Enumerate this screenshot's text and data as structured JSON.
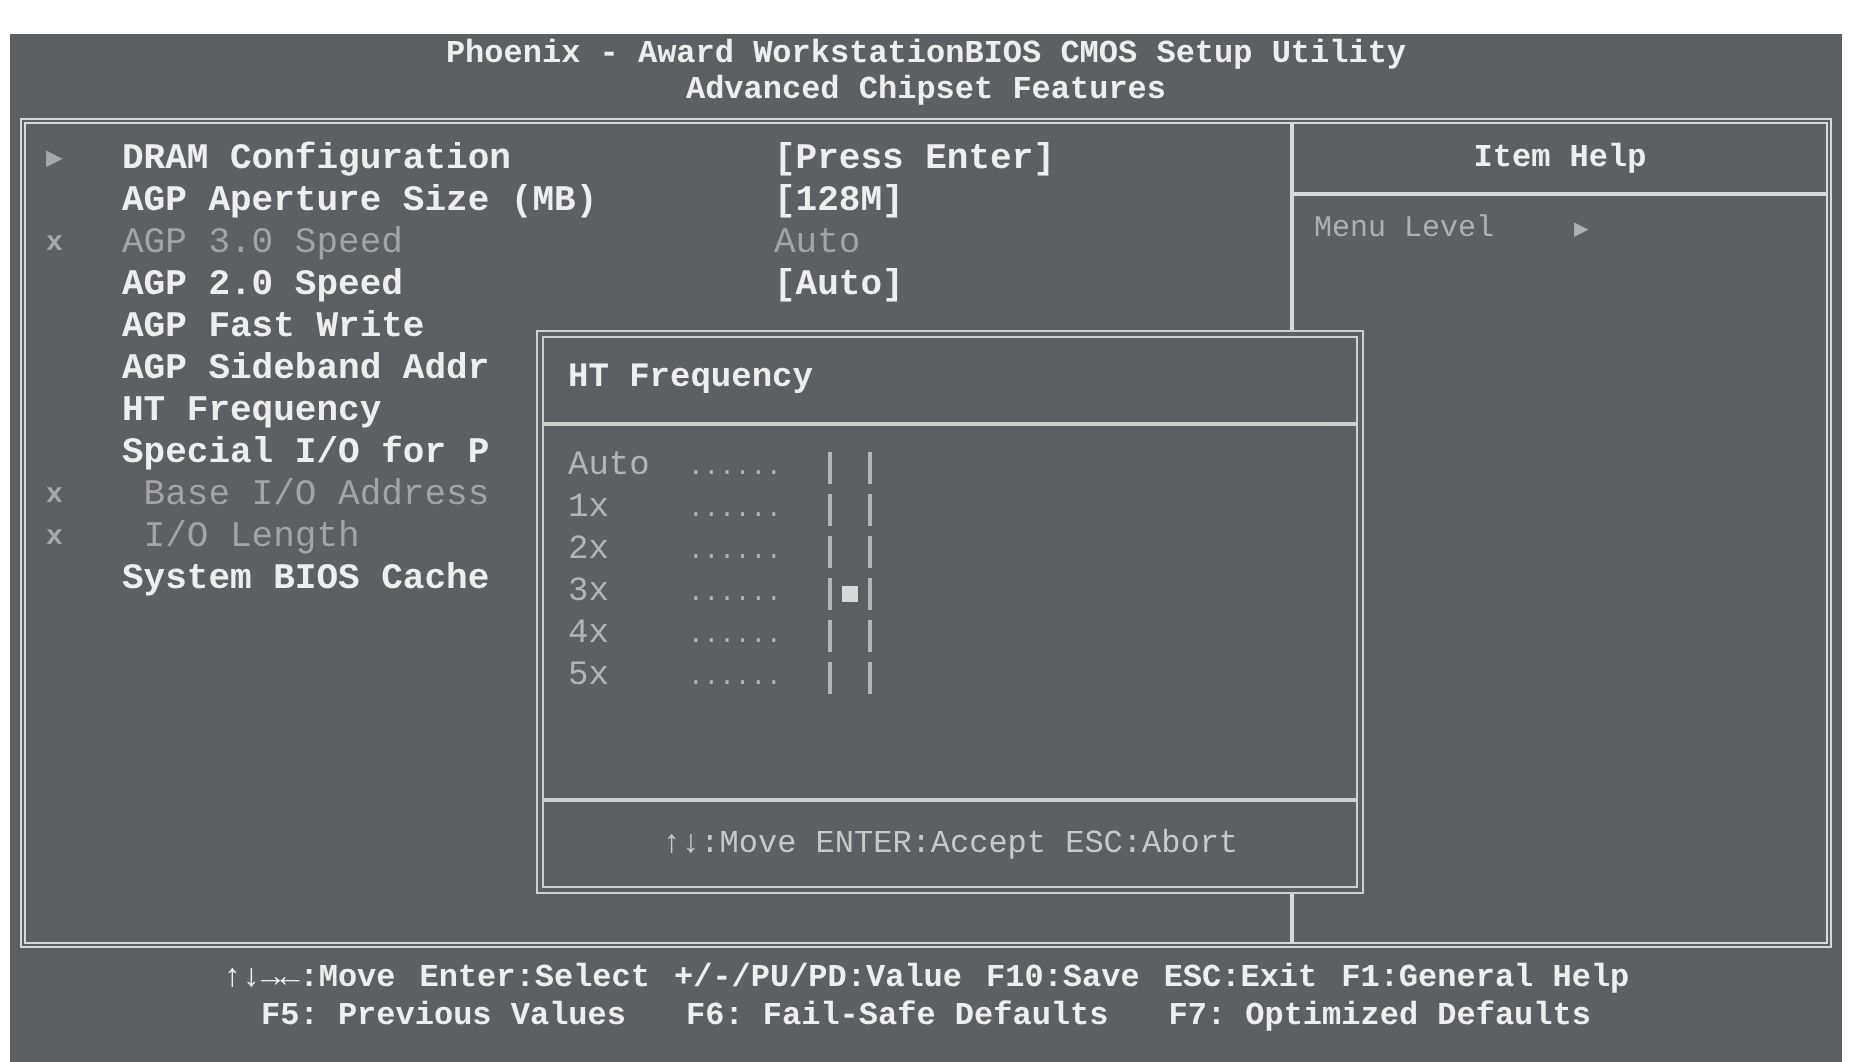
{
  "header": {
    "title": "Phoenix - Award WorkstationBIOS CMOS Setup Utility",
    "subtitle": "Advanced Chipset Features"
  },
  "menu": [
    {
      "marker": "▶",
      "label": "DRAM Configuration",
      "value": "[Press Enter]",
      "disabled": false
    },
    {
      "label": "AGP Aperture Size (MB)",
      "value": "[128M]",
      "disabled": false
    },
    {
      "marker": "x",
      "label": "AGP 3.0 Speed",
      "value": "Auto",
      "disabled": true
    },
    {
      "label": "AGP 2.0 Speed",
      "value": "[Auto]",
      "disabled": false
    },
    {
      "label": "AGP Fast Write",
      "disabled": false
    },
    {
      "label": "AGP Sideband Addr",
      "disabled": false
    },
    {
      "label": "HT Frequency",
      "disabled": false
    },
    {
      "label": "Special I/O for P",
      "disabled": false
    },
    {
      "marker": "x",
      "label": " Base I/O Address",
      "disabled": true
    },
    {
      "marker": "x",
      "label": " I/O Length",
      "disabled": true
    },
    {
      "label": "System BIOS Cache",
      "disabled": false
    }
  ],
  "help": {
    "title": "Item Help",
    "menu_level": "Menu Level",
    "menu_level_marker": "▶"
  },
  "popup": {
    "title": "HT Frequency",
    "options": [
      {
        "label": "Auto",
        "leader": "......",
        "selected": false
      },
      {
        "label": "1x",
        "leader": "......",
        "selected": false
      },
      {
        "label": "2x",
        "leader": "......",
        "selected": false
      },
      {
        "label": "3x",
        "leader": "......",
        "selected": true
      },
      {
        "label": "4x",
        "leader": "......",
        "selected": false
      },
      {
        "label": "5x",
        "leader": "......",
        "selected": false
      }
    ],
    "footer": "↑↓:Move ENTER:Accept ESC:Abort"
  },
  "footer": {
    "line_1": [
      "↑↓→←:Move",
      "Enter:Select",
      "+/-/PU/PD:Value",
      "F10:Save",
      "ESC:Exit",
      "F1:General Help"
    ],
    "line_2": [
      "F5: Previous Values",
      "F6: Fail-Safe Defaults",
      "F7: Optimized Defaults"
    ]
  }
}
